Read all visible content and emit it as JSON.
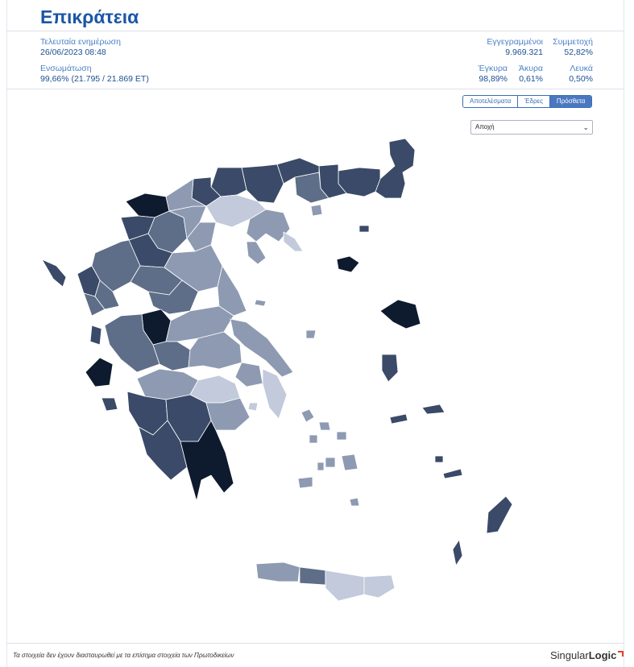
{
  "header": {
    "title": "Επικράτεια"
  },
  "stats": {
    "last_update_label": "Τελευταία ενημέρωση",
    "last_update_value": "26/06/2023 08:48",
    "integration_label": "Ενσωμάτωση",
    "integration_value": "99,66% (21.795 / 21.869 ΕΤ)",
    "registered_label": "Εγγεγραμμένοι",
    "registered_value": "9.969.321",
    "turnout_label": "Συμμετοχή",
    "turnout_value": "52,82%",
    "valid_label": "Έγκυρα",
    "valid_value": "98,89%",
    "invalid_label": "Άκυρα",
    "invalid_value": "0,61%",
    "blank_label": "Λευκά",
    "blank_value": "0,50%"
  },
  "tabs": [
    {
      "label": "Αποτελέσματα",
      "active": false
    },
    {
      "label": "Έδρες",
      "active": false
    },
    {
      "label": "Πρόσθετα",
      "active": true
    }
  ],
  "select": {
    "value": "Αποχή"
  },
  "map": {
    "colors": {
      "darkest": "#0e1a2e",
      "dark": "#3a4a68",
      "mid": "#5e6d88",
      "light": "#8d9ab2",
      "lightest": "#c2cadb",
      "border": "#ffffff"
    }
  },
  "footer": {
    "note": "Τα στοιχεία δεν έχουν διασταυρωθεί με τα επίσημα στοιχεία των Πρωτοδικείων",
    "logo_part1": "Singular",
    "logo_part2": "Logic"
  }
}
